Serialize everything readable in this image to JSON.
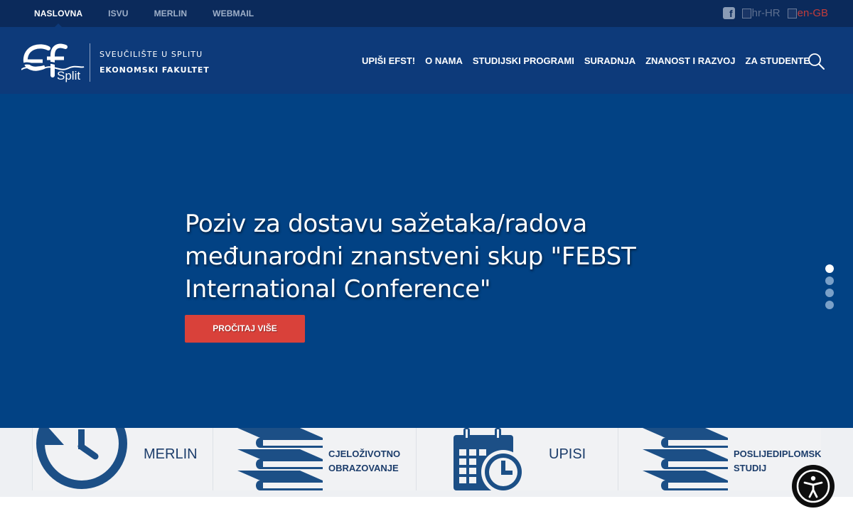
{
  "topbar": {
    "links": [
      {
        "label": "NASLOVNA",
        "active": true
      },
      {
        "label": "ISVU",
        "active": false
      },
      {
        "label": "MERLIN",
        "active": false
      },
      {
        "label": "WEBMAIL",
        "active": false
      }
    ],
    "facebook_icon": "f",
    "lang_hr": "hr-HR",
    "lang_en": "en-GB"
  },
  "header": {
    "logo_text": "Split",
    "university": "SVEUČILIŠTE U SPLITU",
    "faculty": "EKONOMSKI FAKULTET",
    "nav": [
      "UPIŠI EFST!",
      "O NAMA",
      "STUDIJSKI PROGRAMI",
      "SURADNJA",
      "ZNANOST I RAZVOJ",
      "ZA STUDENTE"
    ],
    "search_icon": "search-icon"
  },
  "hero": {
    "title": "Poziv za dostavu sažetaka/radova međunarodni znanstveni skup \"FEBST International Conference\"",
    "button": "PROČITAJ VIŠE",
    "slides": 4,
    "active_slide": 1
  },
  "quicklinks": [
    {
      "label": "MERLIN",
      "icon": "history-icon"
    },
    {
      "label_line1": "CJELOŽIVOTNO",
      "label_line2": "OBRAZOVANJE",
      "icon": "books-icon"
    },
    {
      "label": "UPISI",
      "icon": "calendar-clock-icon"
    },
    {
      "label_line1": "POSLIJEDIPLOMSKI",
      "label_line2": "STUDIJ",
      "icon": "books-icon"
    }
  ],
  "accessibility_icon": "accessibility-icon",
  "colors": {
    "topbar": "#0b2a5b",
    "header": "#0d3a7a",
    "hero": "#024284",
    "button": "#d9413a",
    "icon": "#1c4f86"
  }
}
